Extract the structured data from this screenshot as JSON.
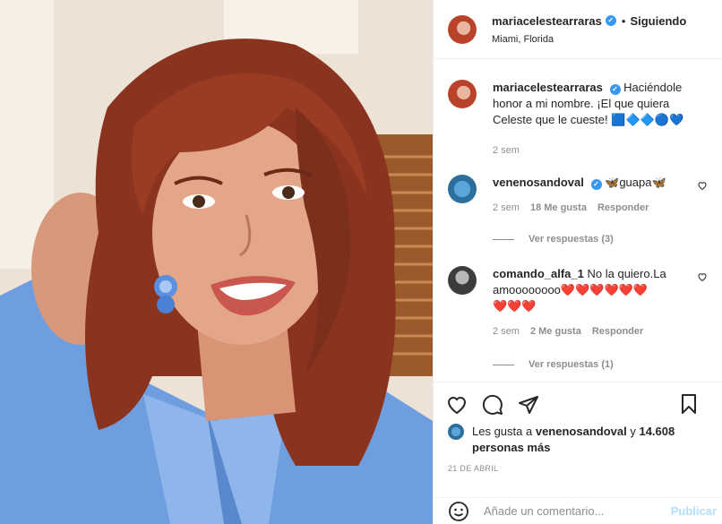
{
  "post": {
    "username": "mariacelestearraras",
    "follow_status": "Siguiendo",
    "separator": "•",
    "location": "Miami, Florida"
  },
  "caption": {
    "username": "mariacelestearraras",
    "text": "Haciéndole honor a mi nombre. ¡El que quiera Celeste que le cueste!",
    "emojis": "🟦🔷🔷🔵💙",
    "time": "2 sem"
  },
  "comments": [
    {
      "username": "venenosandoval",
      "emoji_before": "🦋",
      "text": "guapa",
      "emoji_after": "🦋",
      "time": "2 sem",
      "likes": "18 Me gusta",
      "reply": "Responder",
      "view_replies": "Ver respuestas (3)"
    },
    {
      "username": "comando_alfa_1",
      "text": "No la quiero.La amoooooooo",
      "hearts_line1": "❤️❤️❤️❤️❤️❤️",
      "hearts_line2": "❤️❤️❤️",
      "time": "2 sem",
      "likes": "2 Me gusta",
      "reply": "Responder",
      "view_replies": "Ver respuestas (1)"
    }
  ],
  "likes": {
    "prefix": "Les gusta a",
    "user": "venenosandoval",
    "connector": "y",
    "count": "14.608 personas más"
  },
  "date": "21 DE ABRIL",
  "comment_box": {
    "placeholder": "Añade un comentario...",
    "publish": "Publicar"
  },
  "icons": {
    "like": "heart-outline-icon",
    "comment": "comment-bubble-icon",
    "share": "paper-plane-icon",
    "save": "bookmark-icon",
    "emoji": "smiley-icon",
    "verified": "verified-badge-icon"
  },
  "colors": {
    "verified": "#3897f0",
    "muted": "#8e8e8e",
    "publish_disabled": "#b2dffc",
    "heart": "#ed1c24"
  }
}
